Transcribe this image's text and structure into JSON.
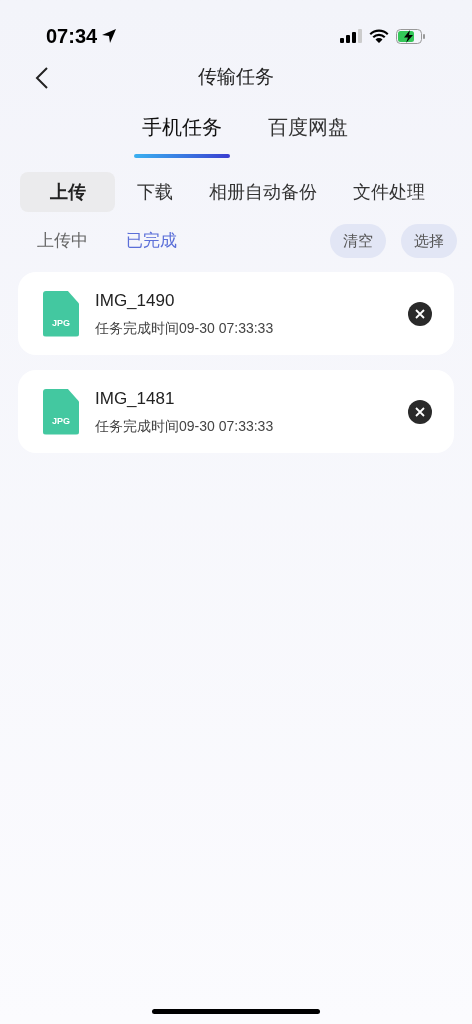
{
  "status_bar": {
    "time": "07:34"
  },
  "nav": {
    "title": "传输任务"
  },
  "top_tabs": [
    {
      "label": "手机任务",
      "selected": true
    },
    {
      "label": "百度网盘",
      "selected": false
    }
  ],
  "category_tabs": [
    {
      "label": "上传",
      "selected": true
    },
    {
      "label": "下载",
      "selected": false
    },
    {
      "label": "相册自动备份",
      "selected": false
    },
    {
      "label": "文件处理",
      "selected": false
    }
  ],
  "sub_tabs": [
    {
      "label": "上传中",
      "selected": false
    },
    {
      "label": "已完成",
      "selected": true
    }
  ],
  "actions": [
    "清空",
    "选择"
  ],
  "tasks": [
    {
      "name": "IMG_1490",
      "file_type": "JPG",
      "detail": "任务完成时间09-30 07:33:33"
    },
    {
      "name": "IMG_1481",
      "file_type": "JPG",
      "detail": "任务完成时间09-30 07:33:33"
    }
  ]
}
